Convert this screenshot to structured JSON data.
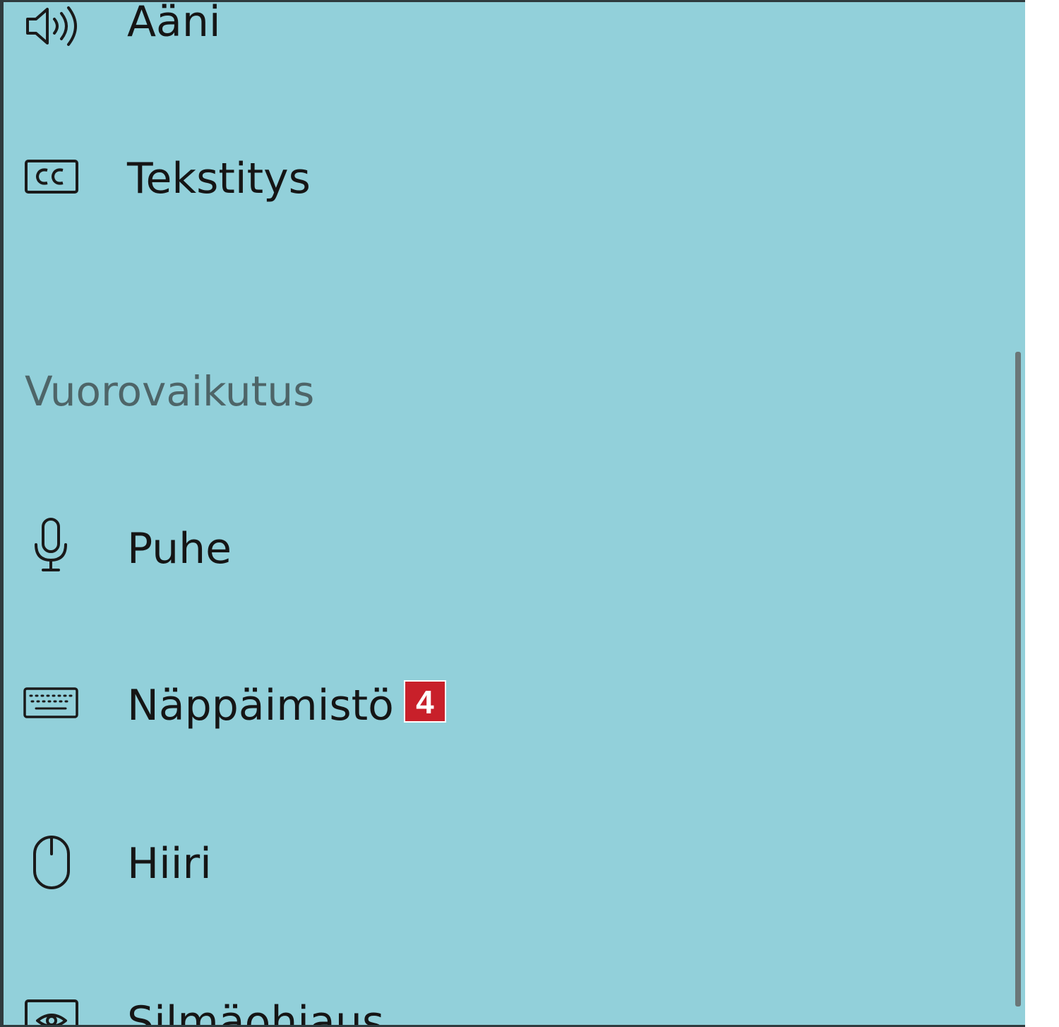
{
  "nav": {
    "items": [
      {
        "label": "Ääni",
        "icon": "speaker-icon"
      },
      {
        "label": "Tekstitys",
        "icon": "closed-captions-icon"
      }
    ],
    "sections": [
      {
        "heading": "Vuorovaikutus",
        "items": [
          {
            "label": "Puhe",
            "icon": "microphone-icon"
          },
          {
            "label": "Näppäimistö",
            "icon": "keyboard-icon",
            "badge": "4"
          },
          {
            "label": "Hiiri",
            "icon": "mouse-icon"
          },
          {
            "label": "Silmäohjaus",
            "icon": "eye-control-icon"
          }
        ]
      }
    ]
  },
  "colors": {
    "panel_background": "#92d0da",
    "badge_background": "#c8202a",
    "heading_text": "#4e6568",
    "item_text": "#151515"
  }
}
